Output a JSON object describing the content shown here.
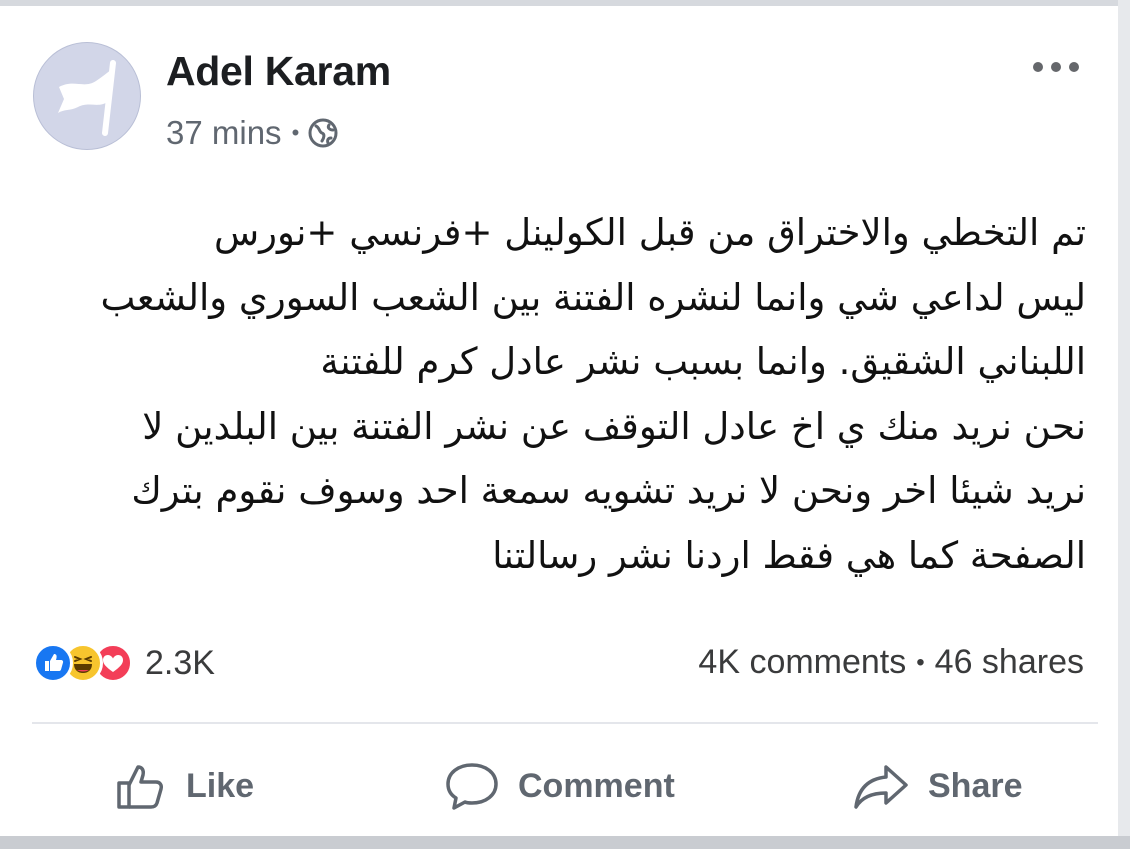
{
  "post": {
    "author": "Adel Karam",
    "time": "37 mins",
    "time_separator": "•",
    "privacy_icon": "globe-icon",
    "options_icon": "more-options-icon",
    "avatar_icon": "flag-icon",
    "body_lines": [
      "تم التخطي والاختراق من قبل الكولينل +فرنسي +نورس",
      "ليس لداعي شي وانما لنشره الفتنة بين الشعب السوري والشعب",
      "اللبناني الشقيق. وانما بسبب نشر عادل كرم للفتنة",
      "نحن نريد منك ي اخ عادل التوقف عن نشر الفتنة بين البلدين لا",
      "نريد شيئا اخر ونحن لا نريد تشويه سمعة احد وسوف نقوم بترك",
      "الصفحة كما هي فقط اردنا نشر رسالتنا"
    ]
  },
  "engagement": {
    "reaction_icons": [
      "like-reaction-icon",
      "haha-reaction-icon",
      "love-reaction-icon"
    ],
    "reaction_count": "2.3K",
    "comments": "4K comments",
    "separator": "•",
    "shares": "46 shares"
  },
  "actions": {
    "like_label": "Like",
    "comment_label": "Comment",
    "share_label": "Share"
  },
  "colors": {
    "like_blue": "#1877f2",
    "haha_yellow": "#f7c52e",
    "love_red": "#f33e58",
    "secondary_text": "#606770"
  }
}
